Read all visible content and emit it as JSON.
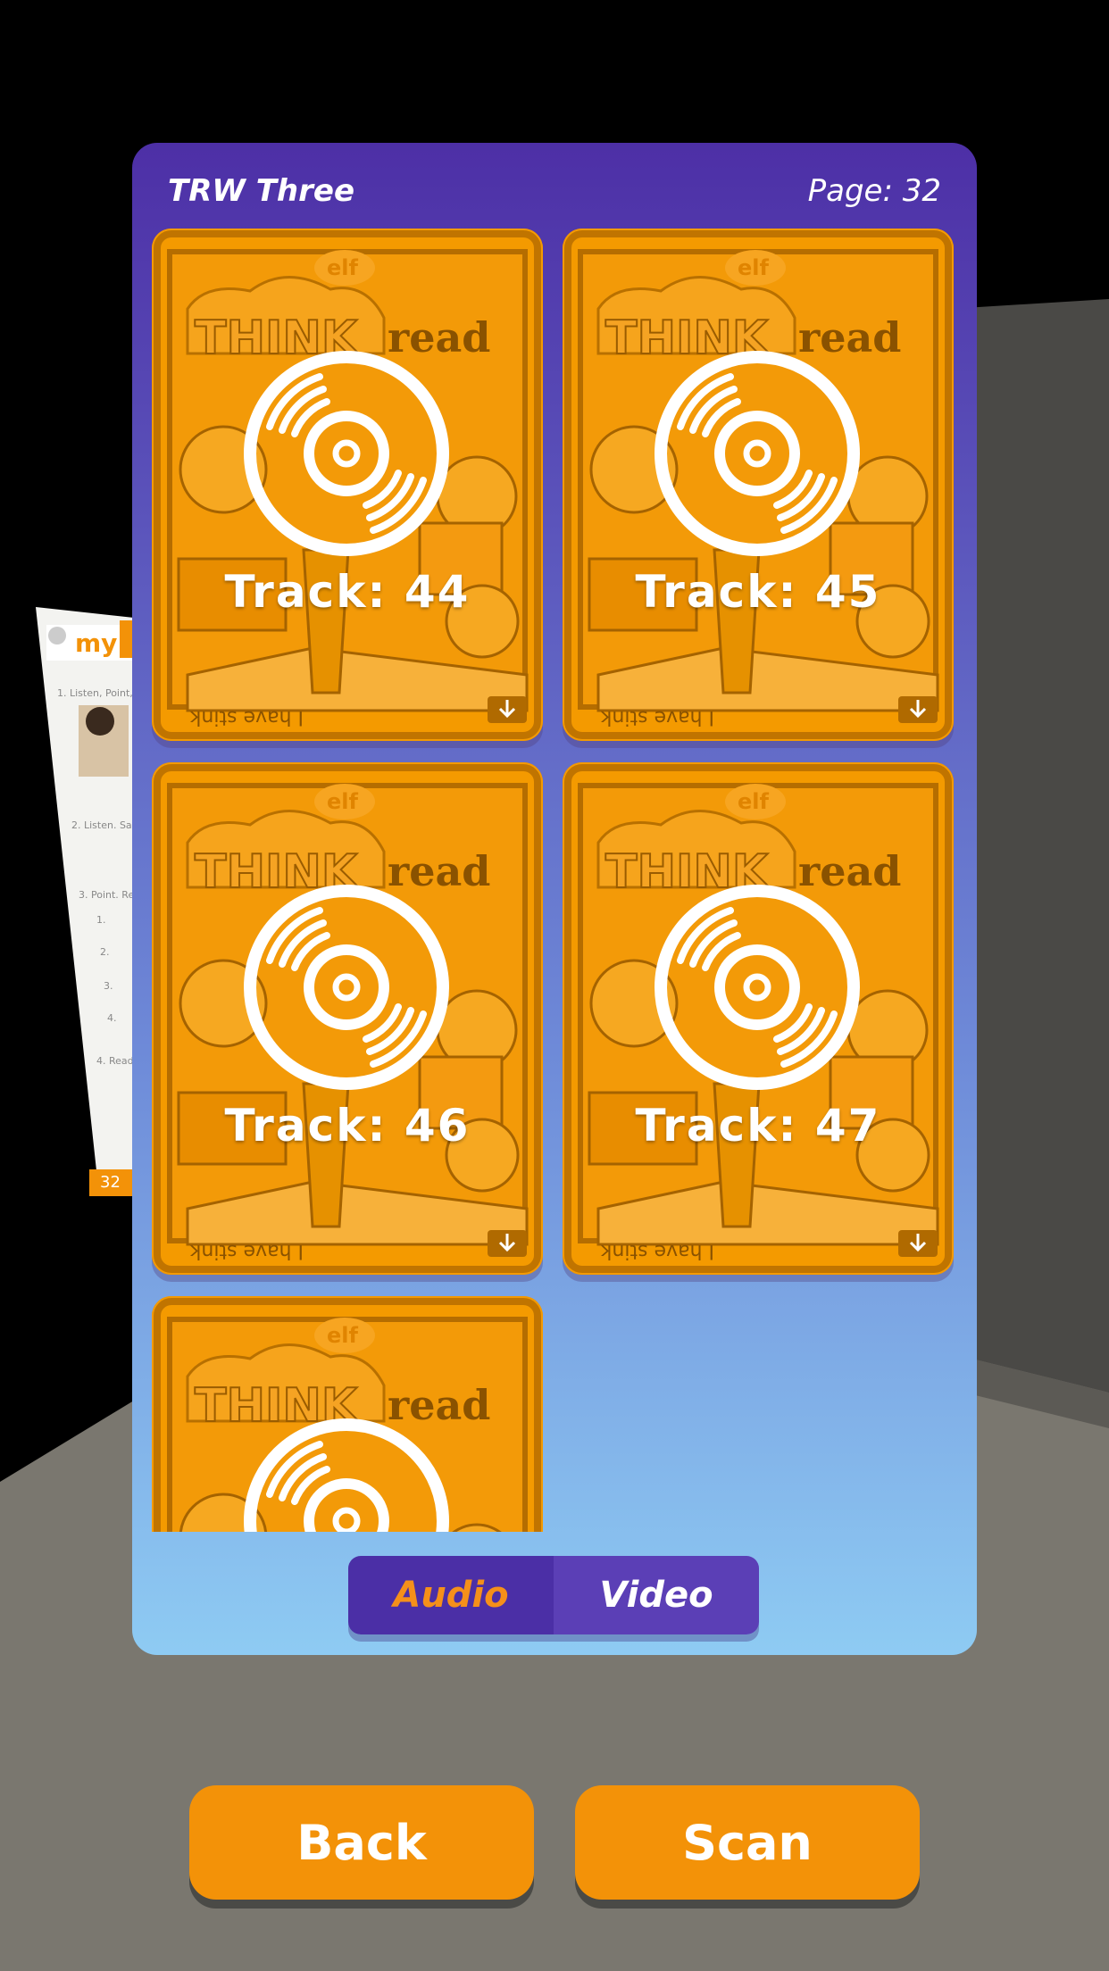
{
  "panel": {
    "title": "TRW Three",
    "page_label": "Page: 32"
  },
  "tracks": [
    {
      "label": "Track: 44"
    },
    {
      "label": "Track: 45"
    },
    {
      "label": "Track: 46"
    },
    {
      "label": "Track: 47"
    },
    {
      "label": ""
    }
  ],
  "cover_text": {
    "think": "THINK",
    "read": "read",
    "footer": "I have stink"
  },
  "tabs": {
    "audio_label": "Audio",
    "video_label": "Video",
    "selected": "Audio"
  },
  "buttons": {
    "back_label": "Back",
    "scan_label": "Scan"
  },
  "colors": {
    "accent_orange": "#f39208",
    "panel_top": "#4d2fa6",
    "panel_bottom": "#8ecbf3"
  }
}
